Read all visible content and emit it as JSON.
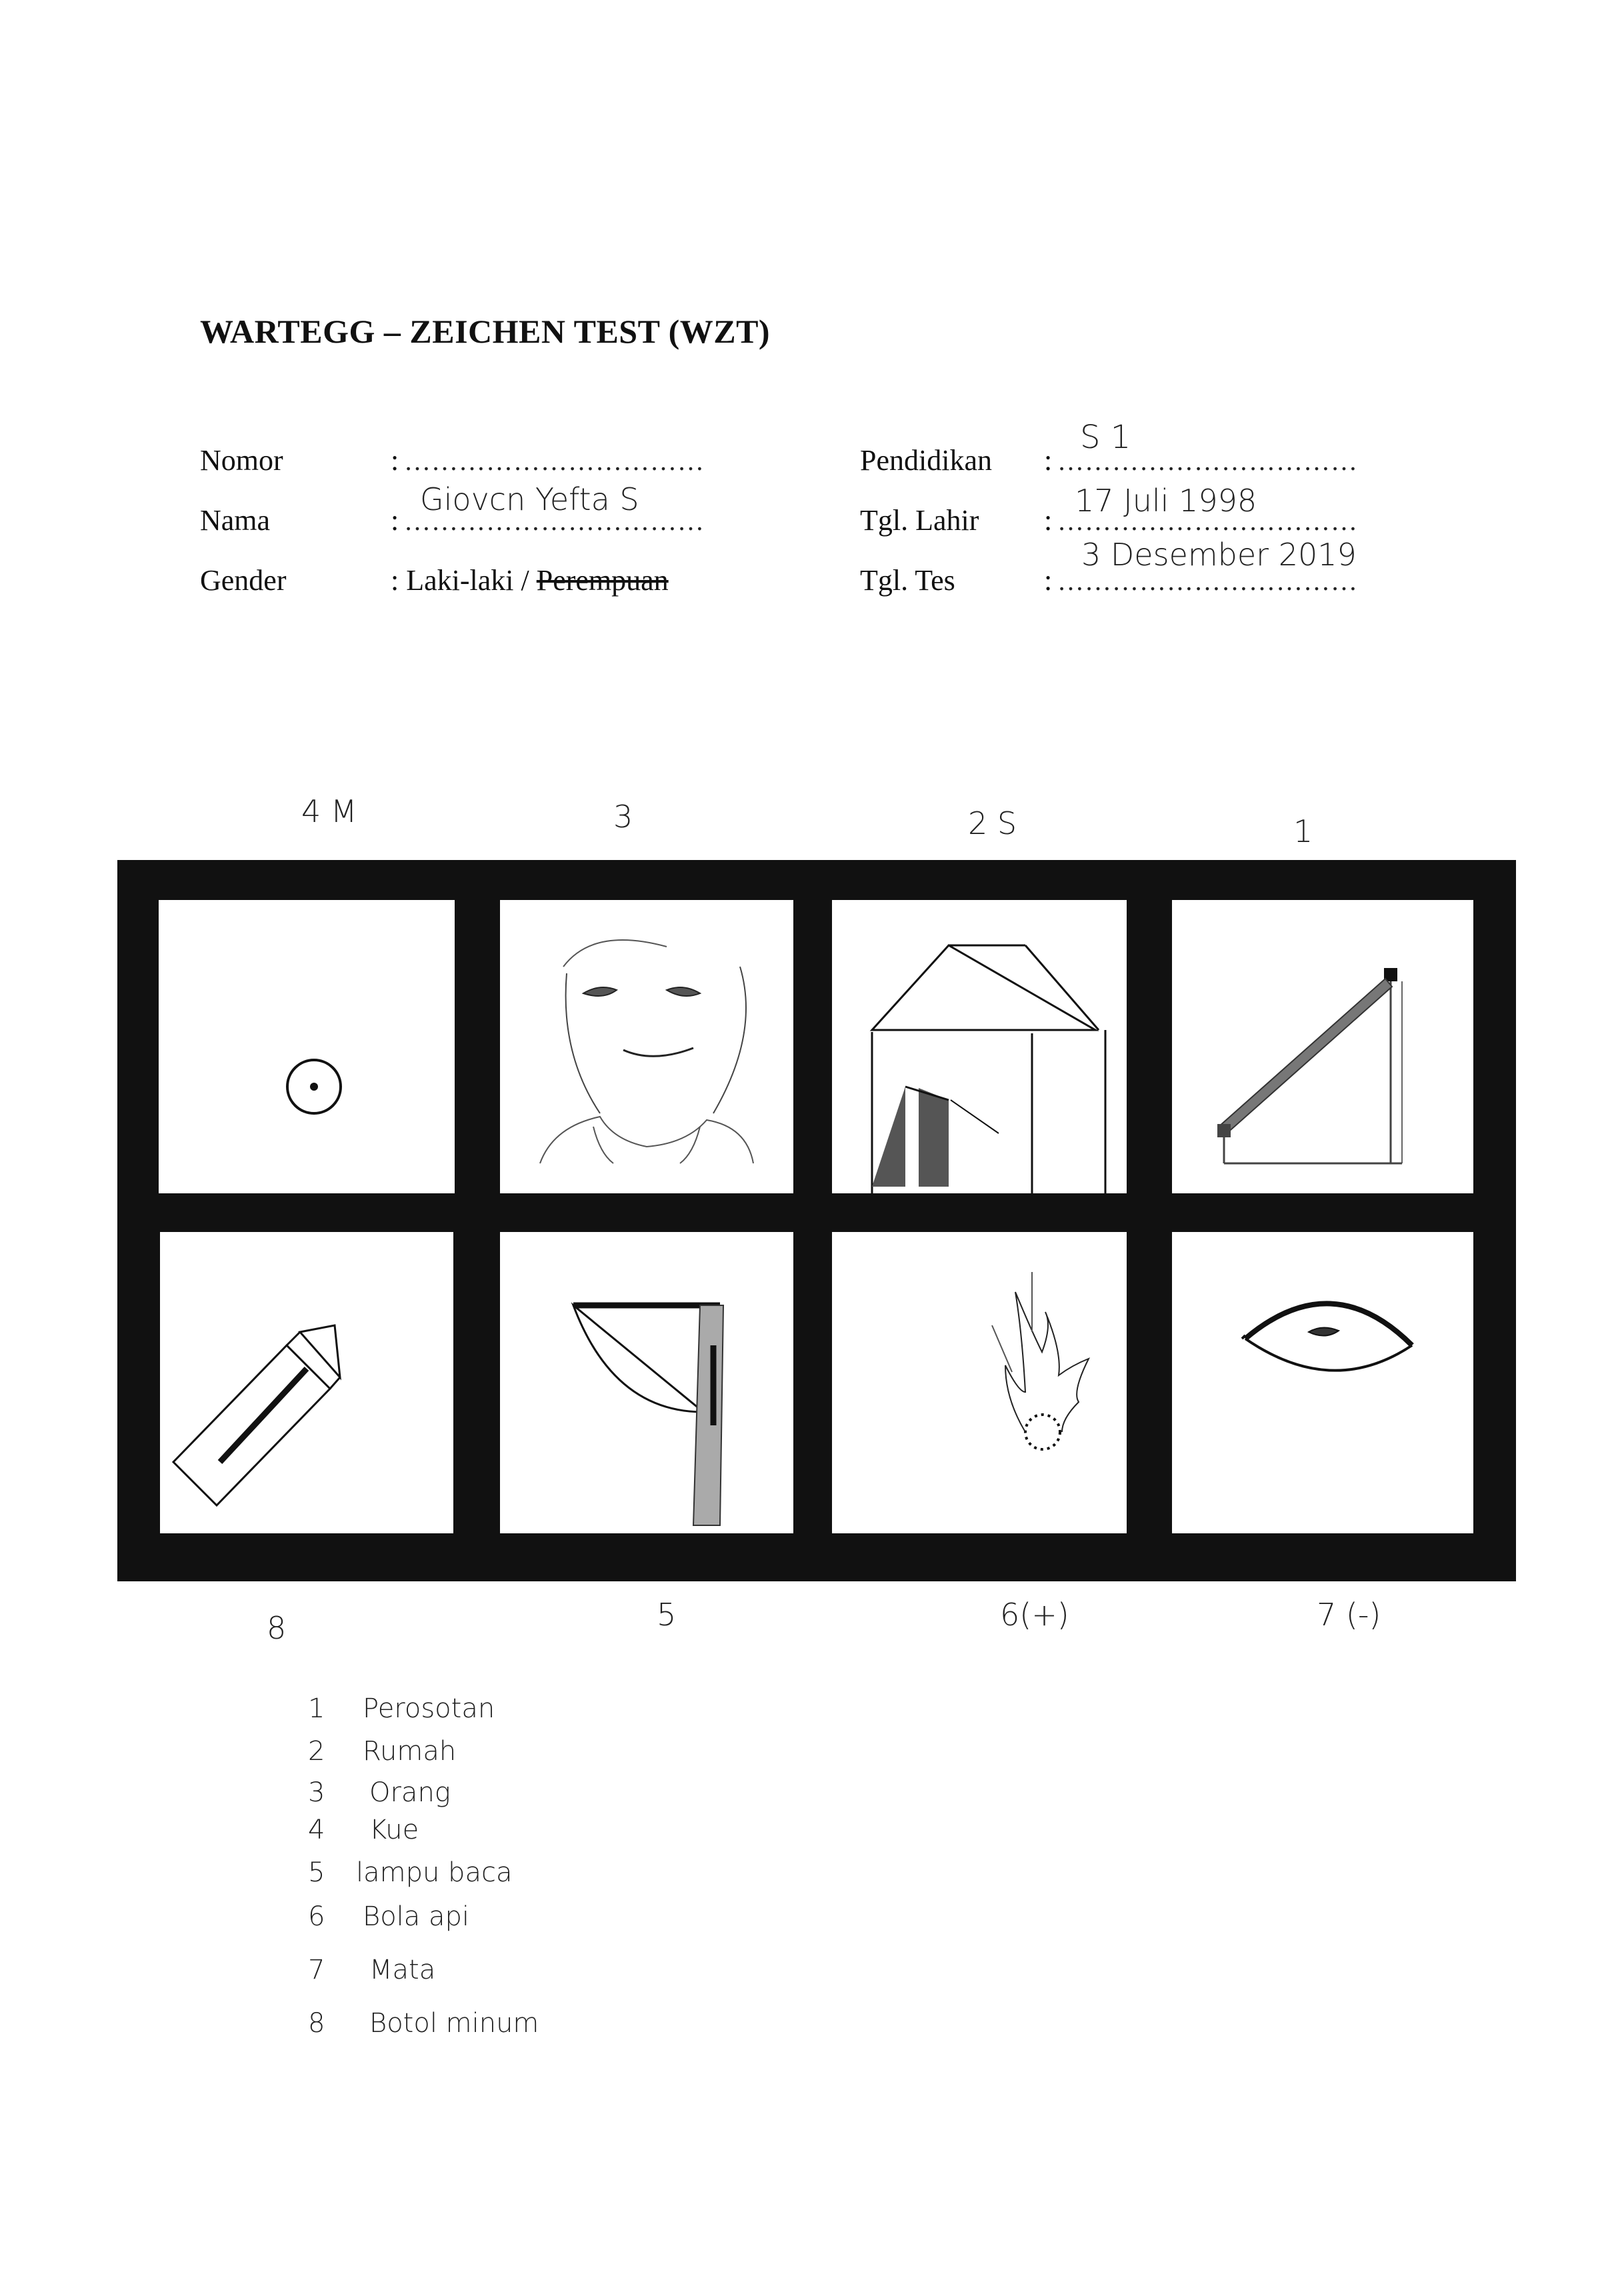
{
  "header": {
    "title": "WARTEGG – ZEICHEN TEST (WZT)",
    "left_fields": [
      {
        "label": "Nomor",
        "colon": ":",
        "dots": "……………………………",
        "handwritten": ""
      },
      {
        "label": "Nama",
        "colon": ":",
        "dots": "……………………………",
        "handwritten": "Giovcn Yefta S"
      },
      {
        "label": "Gender",
        "colon": ":",
        "value_male": "Laki-laki",
        "separator": " / ",
        "value_female_struck": "Perempuan"
      }
    ],
    "right_fields": [
      {
        "label": "Pendidikan",
        "colon": ":",
        "dots": "……………………………",
        "handwritten": "S 1"
      },
      {
        "label": "Tgl. Lahir",
        "colon": ":",
        "dots": "……………………………",
        "handwritten": "17 Juli 1998"
      },
      {
        "label": "Tgl. Tes",
        "colon": ":",
        "dots": "……………………………",
        "handwritten": "3 Desember 2019"
      }
    ]
  },
  "order_top": [
    "4 M",
    "3",
    "2 S",
    "1"
  ],
  "order_bottom": [
    "8",
    "5",
    "6(+)",
    "7 (-)"
  ],
  "interpretations": [
    {
      "num": "1",
      "text": "Perosotan"
    },
    {
      "num": "2",
      "text": "Rumah"
    },
    {
      "num": "3",
      "text": "Orang"
    },
    {
      "num": "4",
      "text": "Kue"
    },
    {
      "num": "5",
      "text": "lampu baca"
    },
    {
      "num": "6",
      "text": "Bola api"
    },
    {
      "num": "7",
      "text": "Mata"
    },
    {
      "num": "8",
      "text": "Botol minum"
    }
  ],
  "colors": {
    "board": "#111111",
    "paper": "#ffffff",
    "ink": "#222222"
  }
}
